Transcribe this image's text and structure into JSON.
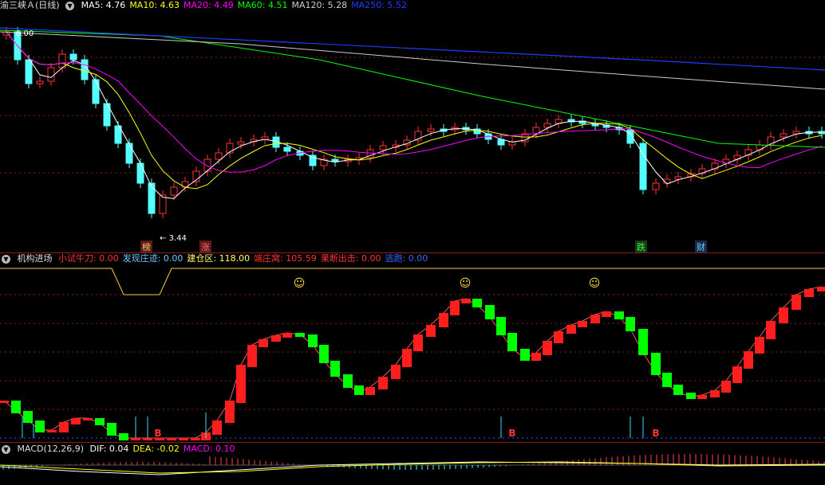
{
  "main": {
    "title": "渝三峡Ａ(日线)",
    "ma": [
      {
        "label": "MA5: 4.76",
        "color": "#ffffff"
      },
      {
        "label": "MA10: 4.63",
        "color": "#ffff00"
      },
      {
        "label": "MA20: 4.49",
        "color": "#ff00ff"
      },
      {
        "label": "MA60: 4.51",
        "color": "#00ff00"
      },
      {
        "label": "MA120: 5.28",
        "color": "#cccccc"
      },
      {
        "label": "MA250: 5.52",
        "color": "#1e3cff"
      }
    ],
    "high_label": "6.00",
    "low_label": "3.44",
    "markers": [
      {
        "text": "榜",
        "color": "#ffcc66",
        "bg": "#5a1a1a"
      },
      {
        "text": "涨",
        "color": "#ff6666",
        "bg": "#5a1a1a"
      },
      {
        "text": "跌",
        "color": "#33ff33",
        "bg": "#1a3a1a"
      },
      {
        "text": "财",
        "color": "#66ccff",
        "bg": "#1a2a4a"
      }
    ]
  },
  "indicator": {
    "name": "机构进场",
    "items": [
      {
        "label": "小试牛刀: 0.00",
        "color": "#ff3333"
      },
      {
        "label": "发现庄迹: 0.00",
        "color": "#66ccff"
      },
      {
        "label": "建仓区: 118.00",
        "color": "#ffff66"
      },
      {
        "label": "端庄窝: 105.59",
        "color": "#ff3333"
      },
      {
        "label": "果断出击: 0.00",
        "color": "#ff3333"
      },
      {
        "label": "逃跑: 0.00",
        "color": "#3366ff"
      }
    ],
    "buy_mark": "B",
    "smiley": "☺"
  },
  "macd": {
    "name": "MACD(12,26,9)",
    "items": [
      {
        "label": "DIF: 0.04",
        "color": "#ffffff"
      },
      {
        "label": "DEA: -0.02",
        "color": "#ffff00"
      },
      {
        "label": "MACD: 0.10",
        "color": "#ff00ff"
      }
    ]
  },
  "colors": {
    "up": "#ff3232",
    "down": "#54ffff",
    "grid": "#8b1a1a"
  }
}
